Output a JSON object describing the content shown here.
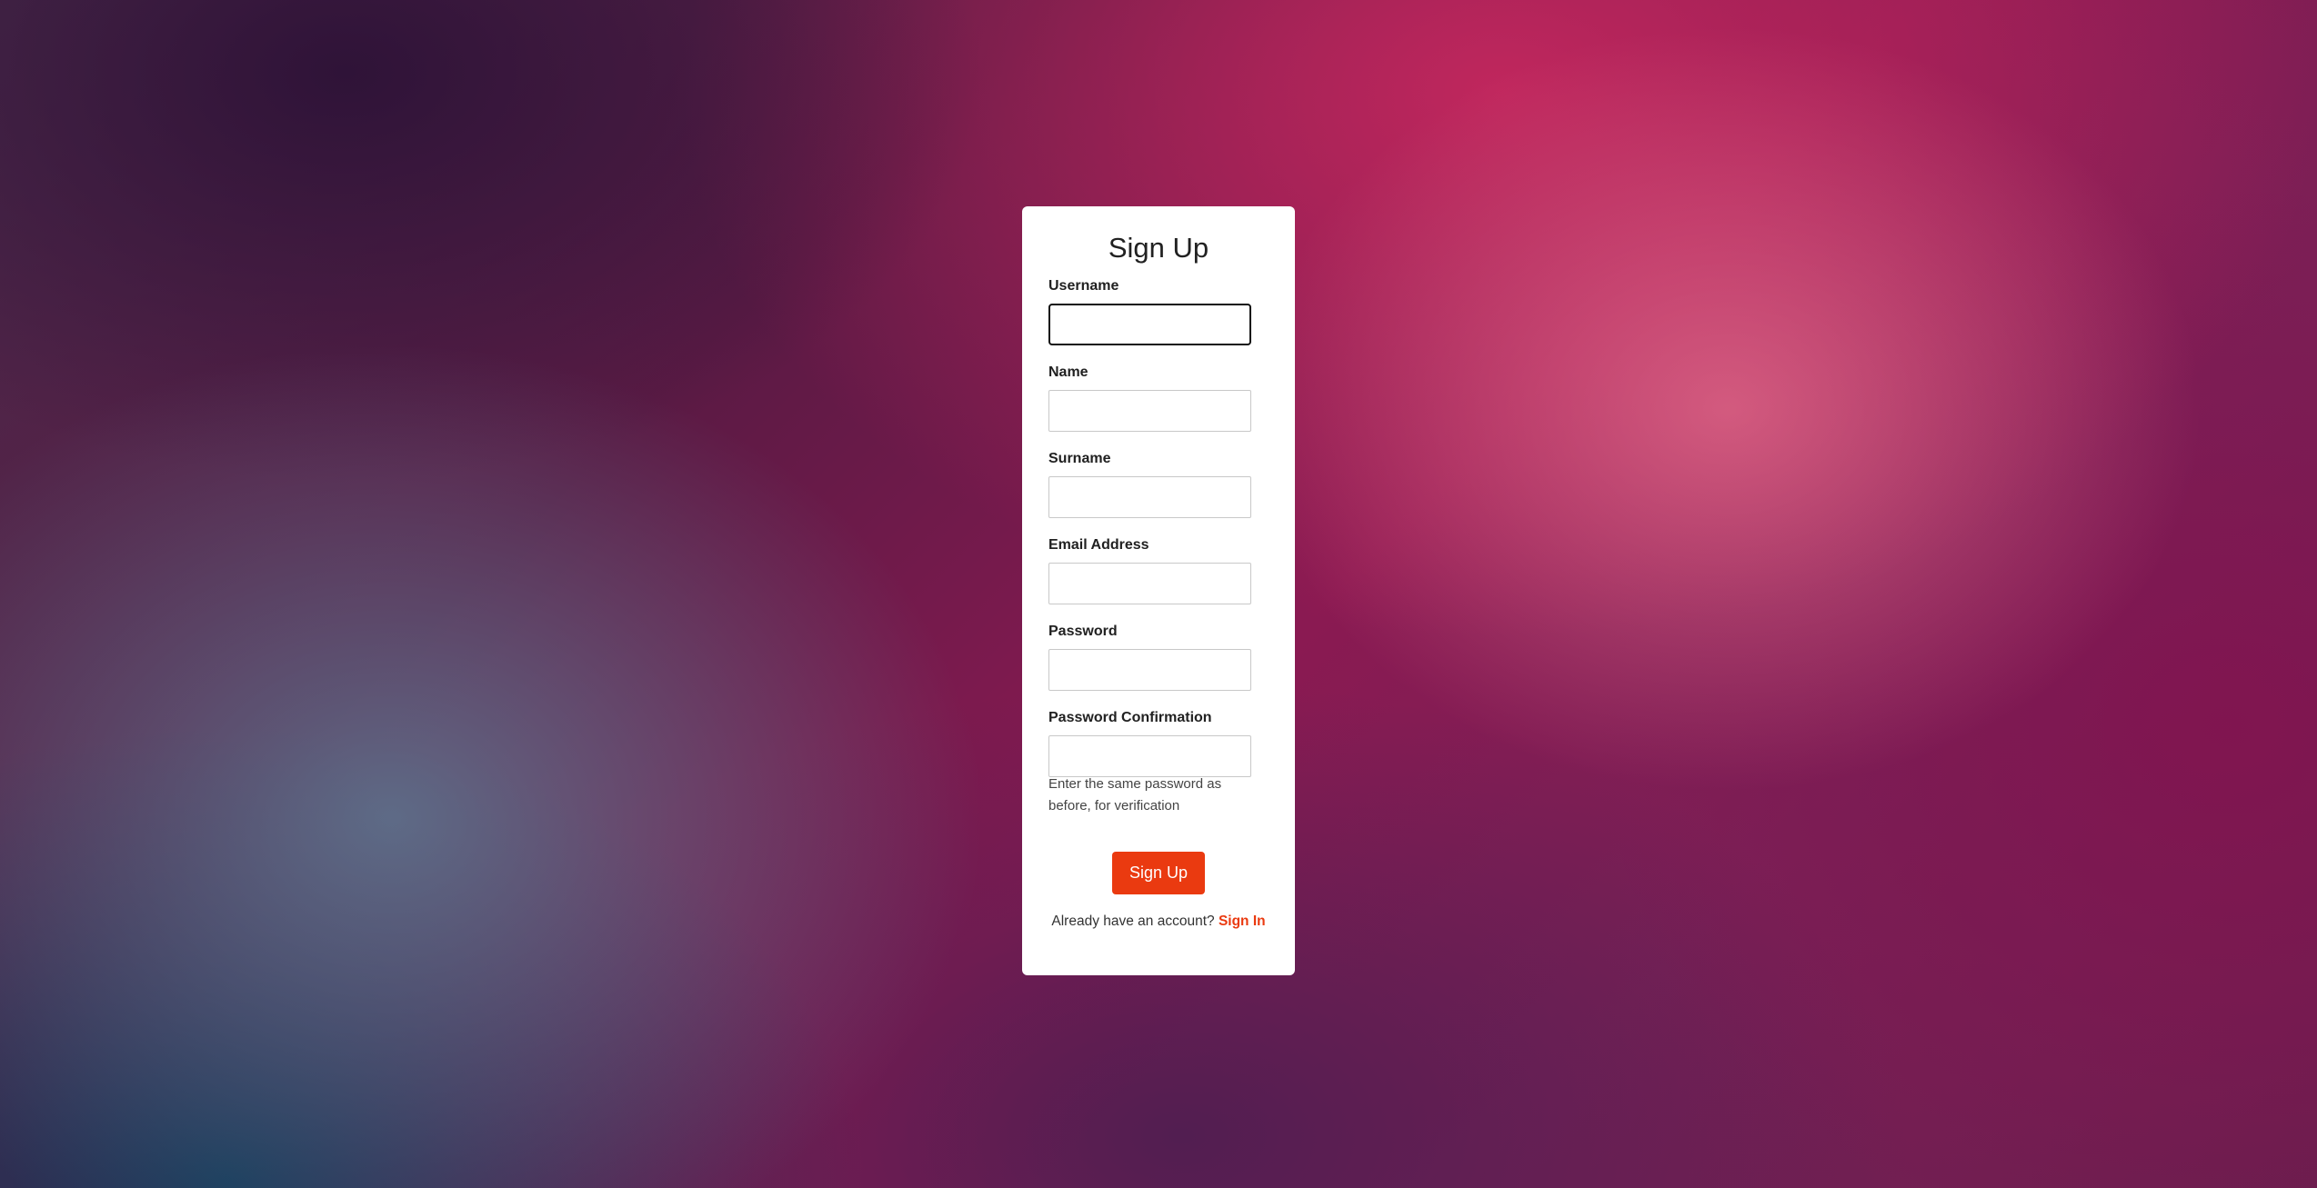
{
  "form": {
    "title": "Sign Up",
    "fields": [
      {
        "label": "Username",
        "value": "",
        "focused": true
      },
      {
        "label": "Name",
        "value": ""
      },
      {
        "label": "Surname",
        "value": ""
      },
      {
        "label": "Email Address",
        "value": ""
      },
      {
        "label": "Password",
        "value": ""
      },
      {
        "label": "Password Confirmation",
        "value": ""
      }
    ],
    "password_confirmation_help": "Enter the same password as before, for verification",
    "submit_label": "Sign Up",
    "signin_prompt": "Already have an account?",
    "signin_link": "Sign In"
  },
  "colors": {
    "accent": "#ea3a10",
    "card_background": "#ffffff"
  }
}
